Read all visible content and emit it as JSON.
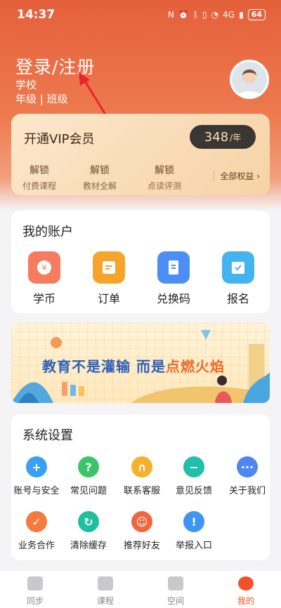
{
  "status": {
    "time": "14:37",
    "battery": "64",
    "network": "4G"
  },
  "profile": {
    "login_label": "登录/注册",
    "school": "学校",
    "grade_class": "年级 | 班级"
  },
  "vip": {
    "title": "开通VIP会员",
    "price": "348",
    "price_unit": "/年",
    "features": [
      {
        "action": "解锁",
        "desc": "付费课程"
      },
      {
        "action": "解锁",
        "desc": "教材全解"
      },
      {
        "action": "解锁",
        "desc": "点读评测"
      }
    ],
    "all_benefits": "全部权益 ›"
  },
  "account": {
    "title": "我的账户",
    "items": [
      {
        "label": "学币",
        "icon": "coin-icon",
        "color": "#f77b5e"
      },
      {
        "label": "订单",
        "icon": "order-icon",
        "color": "#f5a52b"
      },
      {
        "label": "兑换码",
        "icon": "ticket-icon",
        "color": "#4b8ef5"
      },
      {
        "label": "报名",
        "icon": "signup-icon",
        "color": "#43b4f0"
      }
    ]
  },
  "banner": {
    "text_a": "教育不是灌输 而是",
    "text_b": "点燃火焰"
  },
  "settings": {
    "title": "系统设置",
    "items": [
      {
        "label": "账号与安全",
        "icon": "shield-icon",
        "color": "#3aa0f2",
        "glyph": "+"
      },
      {
        "label": "常见问题",
        "icon": "question-icon",
        "color": "#3cc46a",
        "glyph": "?"
      },
      {
        "label": "联系客服",
        "icon": "headset-icon",
        "color": "#f6b12a",
        "glyph": "∩"
      },
      {
        "label": "意见反馈",
        "icon": "feedback-icon",
        "color": "#1fbfa9",
        "glyph": "−"
      },
      {
        "label": "关于我们",
        "icon": "about-icon",
        "color": "#4e86f2",
        "glyph": "···"
      },
      {
        "label": "业务合作",
        "icon": "cooperation-icon",
        "color": "#f47a3d",
        "glyph": "✓"
      },
      {
        "label": "清除缓存",
        "icon": "clear-cache-icon",
        "color": "#1fbfa0",
        "glyph": "↻"
      },
      {
        "label": "推荐好友",
        "icon": "friends-icon",
        "color": "#f2663f",
        "glyph": "☺"
      },
      {
        "label": "举报入口",
        "icon": "report-icon",
        "color": "#3c96f2",
        "glyph": "!"
      }
    ]
  },
  "nav": [
    {
      "label": "同步",
      "icon": "sync-icon"
    },
    {
      "label": "课程",
      "icon": "course-icon"
    },
    {
      "label": "空间",
      "icon": "space-icon"
    },
    {
      "label": "我的",
      "icon": "mine-icon",
      "active": true
    }
  ]
}
